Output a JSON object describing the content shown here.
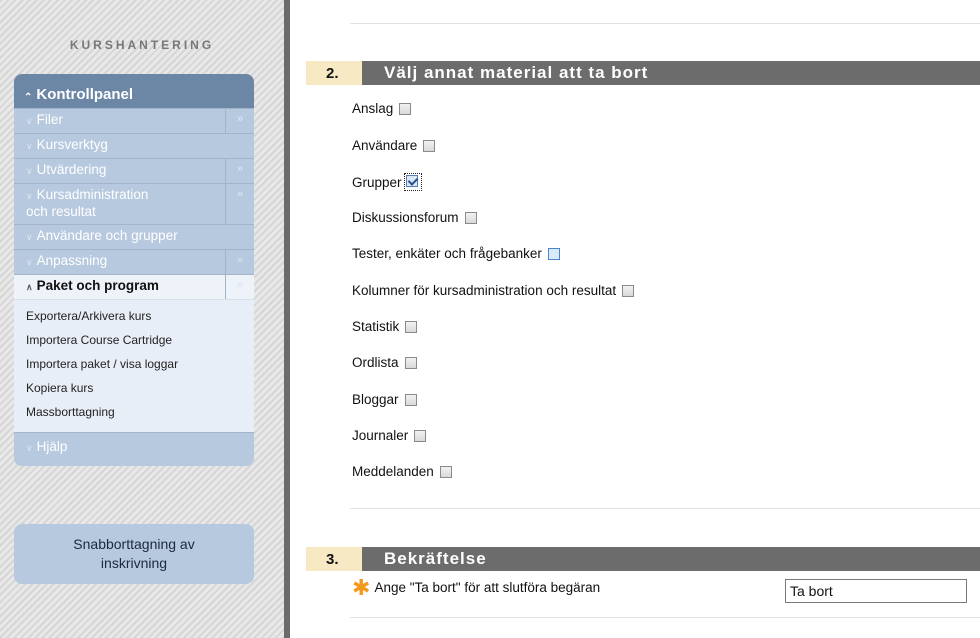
{
  "sidebar": {
    "heading": "KURSHANTERING",
    "menu_title": "Kontrollpanel",
    "items": [
      {
        "label": "Filer",
        "has_arrow": true
      },
      {
        "label": "Kursverktyg",
        "has_arrow": false
      },
      {
        "label": "Utvärdering",
        "has_arrow": true
      },
      {
        "label_line1": "Kursadministration",
        "label_line2": "och resultat",
        "has_arrow": true
      },
      {
        "label": "Användare och grupper",
        "has_arrow": false
      },
      {
        "label": "Anpassning",
        "has_arrow": true
      },
      {
        "label": "Paket och program",
        "has_arrow": true,
        "active": true
      }
    ],
    "submenu": [
      "Exportera/Arkivera kurs",
      "Importera Course Cartridge",
      "Importera paket / visa loggar",
      "Kopiera kurs",
      "Massborttagning"
    ],
    "footer_item": "Hjälp",
    "quick_box_line1": "Snabborttagning av",
    "quick_box_line2": "inskrivning"
  },
  "icons": {
    "expand": "double-chevron-down-icon",
    "collapse": "double-chevron-up-icon",
    "arrow": "double-chevron-right-icon"
  },
  "section2": {
    "number": "2.",
    "title": "Välj annat material att ta bort",
    "options": [
      {
        "label": "Anslag",
        "checked": false
      },
      {
        "label": "Användare",
        "checked": false
      },
      {
        "label": "Grupper",
        "checked": true
      },
      {
        "label": "Diskussionsforum",
        "checked": false
      },
      {
        "label": "Tester, enkäter och frågebanker",
        "checked": false
      },
      {
        "label": "Kolumner för kursadministration och resultat",
        "checked": false
      },
      {
        "label": "Statistik",
        "checked": false
      },
      {
        "label": "Ordlista",
        "checked": false
      },
      {
        "label": "Bloggar",
        "checked": false
      },
      {
        "label": "Journaler",
        "checked": false
      },
      {
        "label": "Meddelanden",
        "checked": false
      }
    ]
  },
  "section3": {
    "number": "3.",
    "title": "Bekräftelse",
    "prompt": "Ange \"Ta bort\" för att slutföra begäran",
    "input_value": "Ta bort"
  },
  "colors": {
    "menu_header": "#6c87a6",
    "menu_body": "#b7c9de",
    "section_bar": "#6c6c6c",
    "section_number_bg": "#f6e9c4",
    "required_star": "#f39a1d"
  }
}
